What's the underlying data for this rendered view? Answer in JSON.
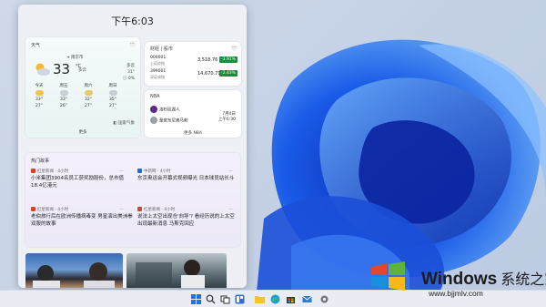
{
  "panel": {
    "time": "下午6:03"
  },
  "weather": {
    "title": "天气",
    "location": "⌖ 南京市",
    "temp": "33",
    "unit": "°C",
    "condition": "多云",
    "side": [
      "多云",
      "31°",
      "ⓘ 0%"
    ],
    "forecast": [
      {
        "day": "今天",
        "high": "33°",
        "low": "27°"
      },
      {
        "day": "周五",
        "high": "33°",
        "low": "26°"
      },
      {
        "day": "周六",
        "high": "32°",
        "low": "27°"
      },
      {
        "day": "周日",
        "high": "35°",
        "low": "27°"
      }
    ],
    "source": "◧ 国家气象",
    "more": "更多"
  },
  "stocks": {
    "title": "财经 | 股市",
    "rows": [
      {
        "code": "000001",
        "name": "上证综指",
        "price": "3,518.76",
        "change": "-3.91%"
      },
      {
        "code": "399001",
        "name": "深证成指",
        "price": "14,670.71",
        "change": "-2.43%"
      }
    ]
  },
  "nba": {
    "title": "NBA",
    "team1": "洛杉矶湖人",
    "team2": "圣安东尼奥马刺",
    "date": "7月4日",
    "time": "上午6:30",
    "more": "更多 NBA"
  },
  "news": {
    "title": "热门故事",
    "items": [
      {
        "source": "红星新闻 · 4小时",
        "title": "小米集团3904名员工获奖励股份，总市值18.4亿港元"
      },
      {
        "source": "中新网 · 4小时",
        "title": "东京奥运会开幕式视频曝光 日本球员站长斗"
      },
      {
        "source": "红星新闻 · 4小时",
        "title": "老伯旅行后在欧洲传播病毒变 男星演出美洲拳双服的故事"
      },
      {
        "source": "红星新闻 · 4小时",
        "title": "说法上太空出现仓'向导'? 看经历说的上太空 出现最新消息 马斯克回应"
      }
    ]
  },
  "taskbar": {
    "icons": [
      "start-icon",
      "search-icon",
      "task-view-icon",
      "widgets-icon",
      "file-explorer-icon",
      "edge-icon",
      "store-icon",
      "mail-icon",
      "settings-icon"
    ]
  },
  "watermark": {
    "title": "Windows",
    "title_suffix": "系统之家",
    "url": "www.bjjmlv.com"
  }
}
